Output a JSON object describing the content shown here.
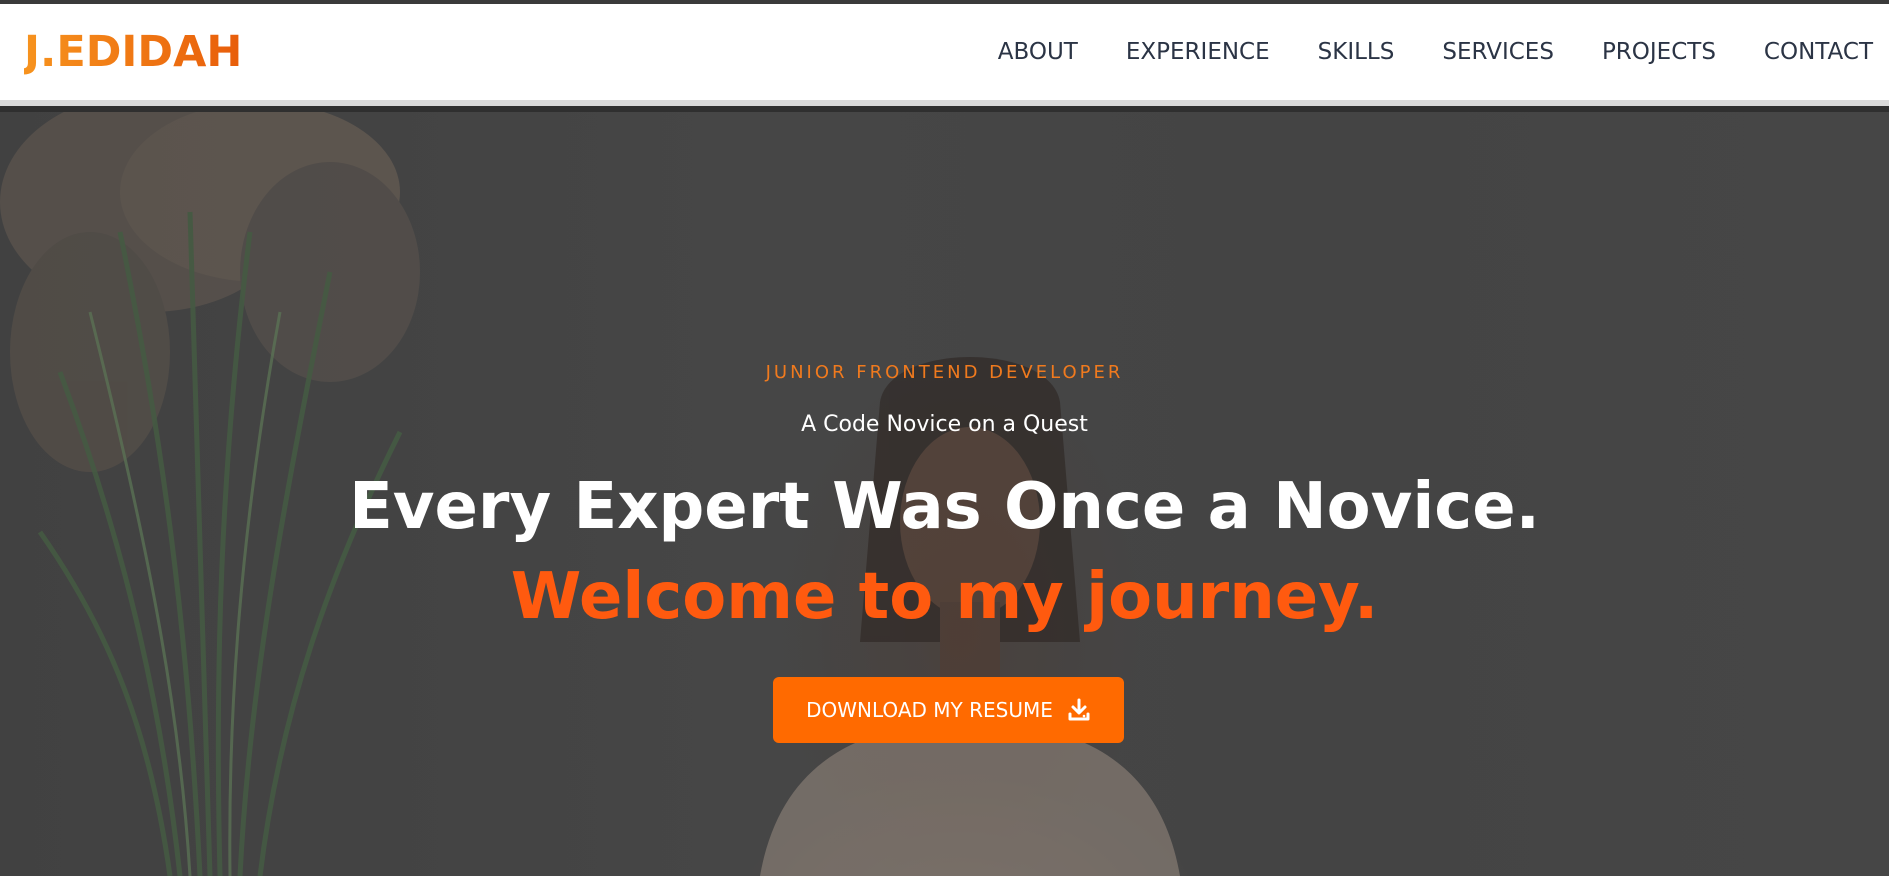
{
  "brand": {
    "logo_text": "J.EDIDAH",
    "accent": "#ff6a00",
    "gradient_start": "#f7931e",
    "gradient_end": "#e85d0a"
  },
  "nav": {
    "items": [
      {
        "label": "ABOUT"
      },
      {
        "label": "EXPERIENCE"
      },
      {
        "label": "SKILLS"
      },
      {
        "label": "SERVICES"
      },
      {
        "label": "PROJECTS"
      },
      {
        "label": "CONTACT"
      }
    ]
  },
  "hero": {
    "kicker": "JUNIOR FRONTEND DEVELOPER",
    "tagline": "A Code Novice on a Quest",
    "headline": "Every Expert Was Once a Novice.",
    "subheadline": "Welcome to my journey.",
    "cta_label": "DOWNLOAD MY RESUME",
    "cta_icon": "download-icon",
    "background": "portrait-with-plant-photo"
  }
}
